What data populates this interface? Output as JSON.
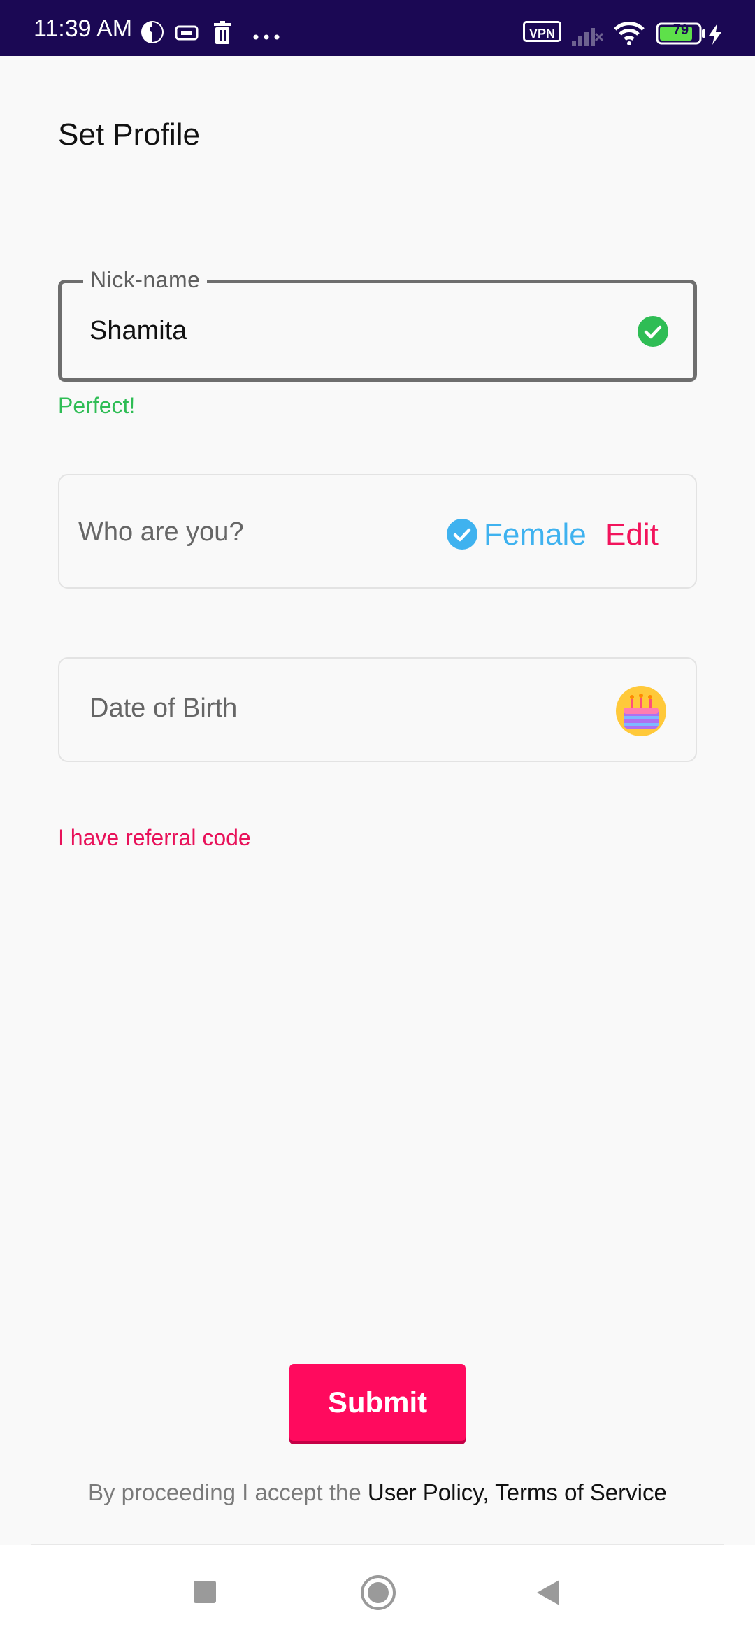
{
  "status_bar": {
    "time": "11:39 AM",
    "vpn": "VPN",
    "battery": "79",
    "icons": [
      "circle-half-icon",
      "sim-card-icon",
      "trash-icon",
      "more-dots-icon",
      "signal-icon",
      "wifi-icon",
      "battery-icon",
      "charging-icon"
    ]
  },
  "header": {
    "title": "Set Profile"
  },
  "nickname": {
    "label": "Nick-name",
    "value": "Shamita",
    "helper": "Perfect!",
    "status_color": "#2fbd55"
  },
  "gender": {
    "label": "Who are you?",
    "value": "Female",
    "edit": "Edit",
    "value_color": "#3fb2ef"
  },
  "dob": {
    "label": "Date of Birth",
    "icon": "birthday-cake-icon"
  },
  "referral": {
    "label": "I have referral code"
  },
  "submit": {
    "label": "Submit",
    "color": "#ff0a5e"
  },
  "legal": {
    "prefix": "By proceeding I accept the",
    "user_policy": "User Policy",
    "separator": ",",
    "terms": "Terms of Service"
  },
  "nav_bar": {
    "icons": [
      "recents-square-icon",
      "home-circle-icon",
      "back-triangle-icon"
    ]
  }
}
